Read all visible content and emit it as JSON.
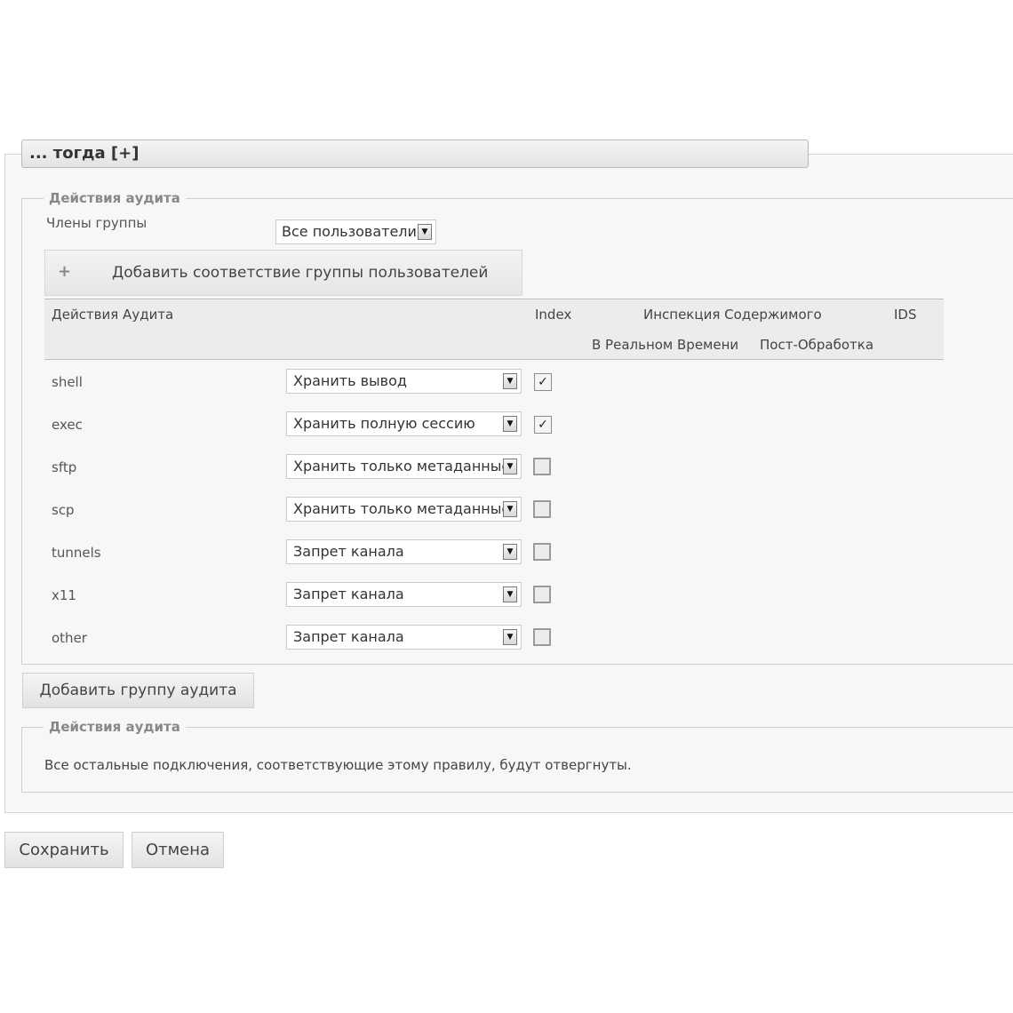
{
  "panel": {
    "title": "... тогда [+]"
  },
  "audit_group": {
    "legend": "Действия аудита",
    "group_members_label": "Члены группы",
    "group_members_value": "Все пользователи",
    "add_match_icon": "+",
    "add_match_label": "Добавить соответствие группы пользователей"
  },
  "table": {
    "headers": {
      "actions": "Действия Аудита",
      "index": "Index",
      "content_inspection": "Инспекция Содержимого",
      "ids": "IDS",
      "realtime": "В Реальном Времени",
      "post_processing": "Пост-Обработка"
    },
    "rows": [
      {
        "name": "shell",
        "action": "Хранить вывод",
        "index": true
      },
      {
        "name": "exec",
        "action": "Хранить полную сессию",
        "index": true
      },
      {
        "name": "sftp",
        "action": "Хранить только метаданные",
        "index": false
      },
      {
        "name": "scp",
        "action": "Хранить только метаданные",
        "index": false
      },
      {
        "name": "tunnels",
        "action": "Запрет канала",
        "index": false
      },
      {
        "name": "x11",
        "action": "Запрет канала",
        "index": false
      },
      {
        "name": "other",
        "action": "Запрет канала",
        "index": false
      }
    ]
  },
  "add_audit_group_label": "Добавить группу аудита",
  "default_actions": {
    "legend": "Действия аудита",
    "text": "Все остальные подключения, соответствующие этому правилу, будут отвергнуты."
  },
  "footer": {
    "save_label": "Сохранить",
    "cancel_label": "Отмена"
  },
  "icons": {
    "dropdown": "chevron-down-icon",
    "check": "checkmark-icon"
  }
}
